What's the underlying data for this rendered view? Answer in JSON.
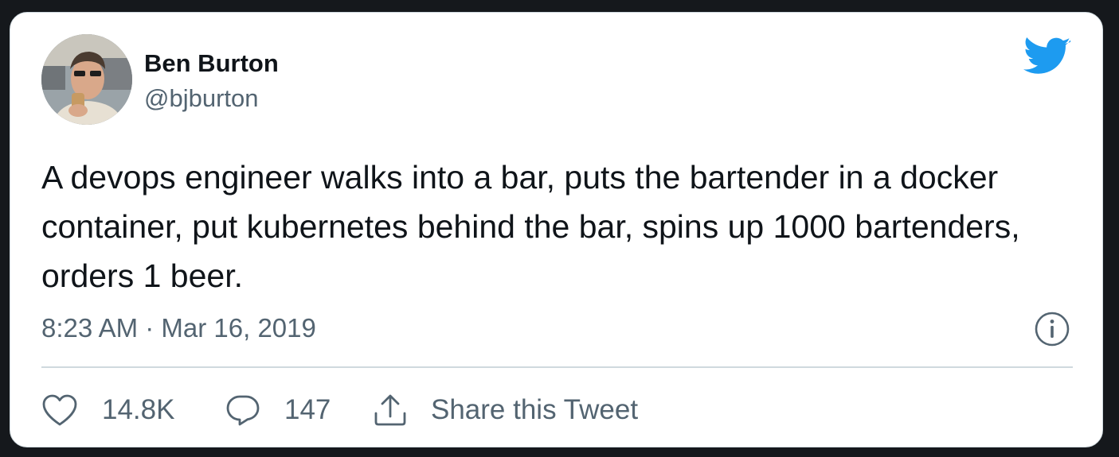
{
  "author": {
    "name": "Ben Burton",
    "handle": "@bjburton",
    "avatar_icon": "user-avatar-photo"
  },
  "tweet": {
    "text": "A devops engineer walks into a bar, puts the bartender in a docker container, put kubernetes behind the bar, spins up 1000 bartenders, orders 1 beer.",
    "timestamp": "8:23 AM · Mar 16, 2019"
  },
  "actions": {
    "likes": "14.8K",
    "replies": "147",
    "share_label": "Share this Tweet"
  },
  "icons": {
    "brand": "twitter-bird-icon",
    "info": "info-icon",
    "like": "heart-icon",
    "reply": "speech-bubble-icon",
    "share": "share-upload-icon"
  },
  "colors": {
    "brand": "#1d9bf0",
    "text": "#0f1419",
    "muted": "#536471",
    "border": "#cfd9de",
    "background": "#15181c"
  }
}
